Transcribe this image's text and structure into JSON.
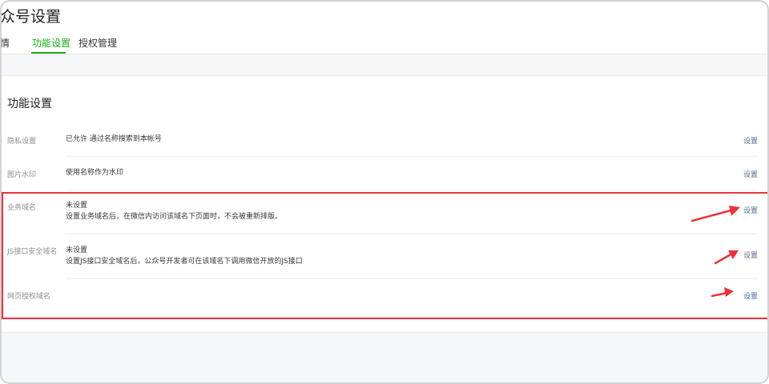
{
  "header": {
    "title": "众号设置",
    "tabs": [
      {
        "label": "详情"
      },
      {
        "label": "功能设置"
      },
      {
        "label": "授权管理"
      }
    ],
    "active_tab": "功能设置"
  },
  "section": {
    "title": "功能设置",
    "rows": [
      {
        "label": "隐私设置",
        "value": "已允许 通过名称搜索到本帐号",
        "desc": "",
        "action": "设置"
      },
      {
        "label": "图片水印",
        "value": "使用名称作为水印",
        "desc": "",
        "action": "设置"
      },
      {
        "label": "业务域名",
        "value": "未设置",
        "desc": "设置业务域名后，在微信内访问该域名下页面时，不会被重新排版。",
        "action": "设置"
      },
      {
        "label": "JS接口安全域名",
        "value": "未设置",
        "desc": "设置JS接口安全域名后，公众号开发者可在该域名下调用微信开放的JS接口",
        "action": "设置"
      },
      {
        "label": "网页授权域名",
        "value": "",
        "desc": "",
        "action": "设置"
      }
    ]
  },
  "colors": {
    "accent": "#1aad19",
    "link": "#576b95",
    "annotation": "#e8323c"
  }
}
